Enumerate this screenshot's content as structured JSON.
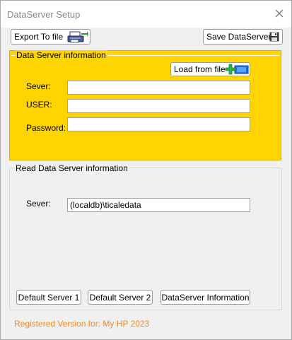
{
  "window": {
    "title": "DataServer Setup"
  },
  "toolbar": {
    "export_label": "Export To file",
    "save_label": "Save DataServer"
  },
  "server_info": {
    "legend": "Data Server information",
    "load_label": "Load from file",
    "sever_label": "Sever:",
    "sever_value": "",
    "user_label": "USER:",
    "user_value": "",
    "password_label": "Password:",
    "password_value": ""
  },
  "read_info": {
    "legend": "Read Data Server information",
    "sever_label": "Sever:",
    "sever_value": "(localdb)\\ticaledata"
  },
  "buttons": {
    "default1": "Default Server 1",
    "default2": "Default Server 2",
    "info": "DataServer Information"
  },
  "footer": {
    "text": "Registered Version for: My HP 2023"
  },
  "colors": {
    "group_background": "#ffd400",
    "footer_text": "#f08a24"
  },
  "icons": {
    "export": "printer-export-icon",
    "save": "floppy-disk-icon",
    "load": "load-file-icon",
    "close": "close-icon"
  }
}
